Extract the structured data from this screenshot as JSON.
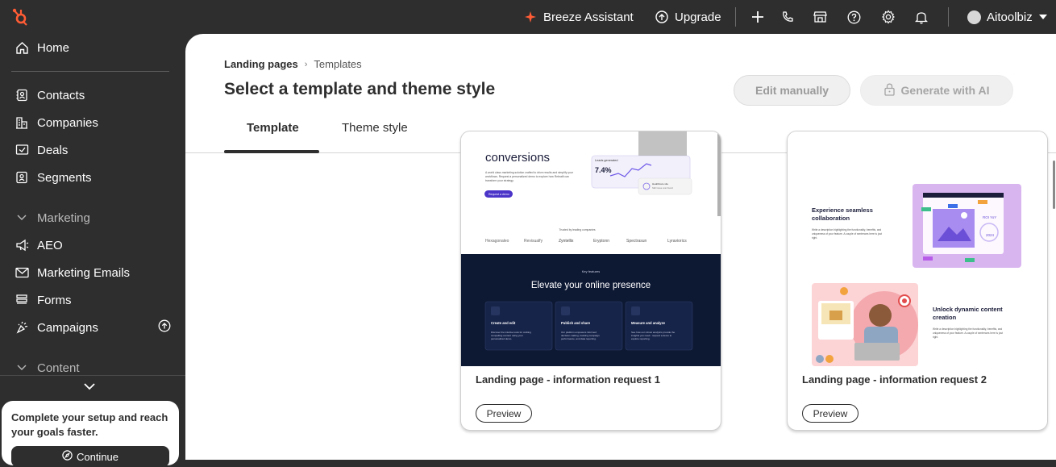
{
  "topbar": {
    "assistant_label": "Breeze Assistant",
    "upgrade_label": "Upgrade",
    "account_name": "Aitoolbiz",
    "colors": {
      "brand": "#ff5c35",
      "bar": "#2e2e2e"
    }
  },
  "sidebar": {
    "home": "Home",
    "items": [
      {
        "label": "Contacts",
        "icon": "contacts-icon"
      },
      {
        "label": "Companies",
        "icon": "companies-icon"
      },
      {
        "label": "Deals",
        "icon": "deals-icon"
      },
      {
        "label": "Segments",
        "icon": "segments-icon"
      }
    ],
    "marketing_section": "Marketing",
    "marketing_items": [
      {
        "label": "AEO",
        "icon": "aeo-icon"
      },
      {
        "label": "Marketing Emails",
        "icon": "email-icon"
      },
      {
        "label": "Forms",
        "icon": "forms-icon"
      },
      {
        "label": "Campaigns",
        "icon": "campaigns-icon"
      }
    ],
    "content_section": "Content",
    "setup_text": "Complete your setup and reach your goals faster.",
    "continue_label": "Continue"
  },
  "main": {
    "breadcrumb_root": "Landing pages",
    "breadcrumb_current": "Templates",
    "title": "Select a template and theme style",
    "edit_manually": "Edit manually",
    "generate_ai": "Generate with AI",
    "tabs": [
      "Template",
      "Theme style"
    ],
    "active_tab": "Template"
  },
  "templates": [
    {
      "name": "Landing page - information request 1",
      "preview_label": "Preview",
      "thumb": {
        "hero_heading": "conversions",
        "hero_text": "A world class marketing solution crafted to drive results and simplify your workflows. Request a personalized demo to explore how Rebrailt can transform your strategy.",
        "cta": "Request a demo",
        "stat_label": "Leads generated",
        "stat_value": "7.4%",
        "trusted_by": "Trusted by leading companies",
        "logos": [
          "Hexagonaleo",
          "Revisualfy",
          "Zyntellix",
          "Eryptonn",
          "Spectrasun",
          "Lyraviorics"
        ],
        "section_kicker": "Key features",
        "section_heading": "Elevate your online presence",
        "features": [
          {
            "title": "Create and edit",
            "text": "Discover the intuitive tools for crafting compelling content using your personalized demo."
          },
          {
            "title": "Publish and share",
            "text": "Our platform empowers informed decision-making, tracking campaign performance, and data reporting."
          },
          {
            "title": "Measure and analyze",
            "text": "See how our robust analytics provide the insights you need - request a demo to explore reporting."
          }
        ]
      }
    },
    {
      "name": "Landing page - information request 2",
      "preview_label": "Preview",
      "thumb": {
        "block1_heading": "Experience seamless collaboration",
        "block1_text": "Write a description highlighting the functionality, benefits, and uniqueness of your feature. A couple of sentences here is just right.",
        "block2_heading": "Unlock dynamic content creation",
        "block2_text": "Write a description highlighting the functionality, benefits, and uniqueness of your feature. A couple of sentences here is just right.",
        "chip_text": "ROI YoY",
        "chip_year": "2024"
      }
    }
  ]
}
